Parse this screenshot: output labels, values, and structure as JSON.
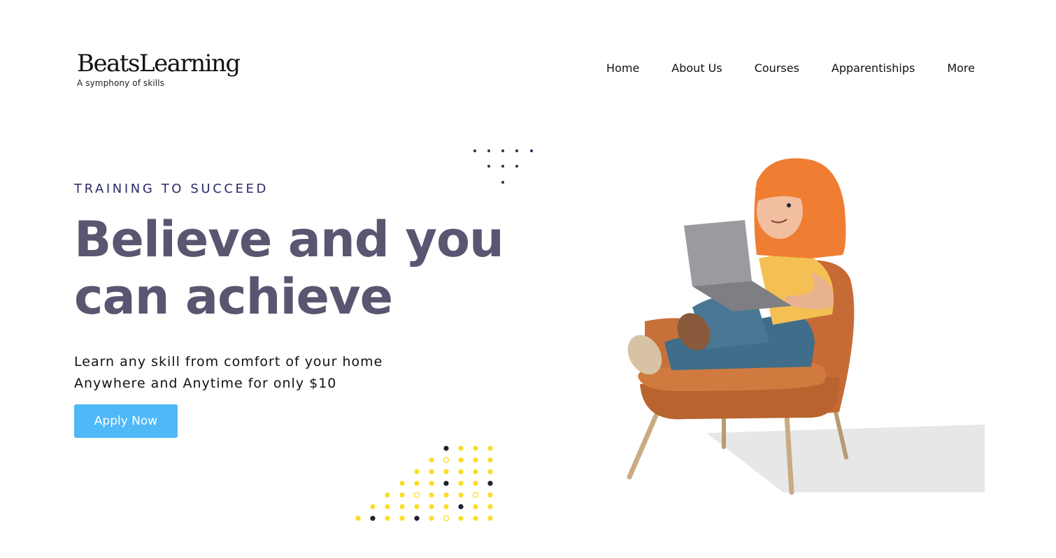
{
  "brand": {
    "name": "BeatsLearning",
    "tagline": "A symphony of skills"
  },
  "nav": {
    "items": [
      {
        "label": "Home"
      },
      {
        "label": "About Us"
      },
      {
        "label": "Courses"
      },
      {
        "label": "Apparentiships"
      },
      {
        "label": "More"
      }
    ]
  },
  "hero": {
    "eyebrow": "TRAINING TO SUCCEED",
    "headline_line1": "Believe and you",
    "headline_line2": "can achieve",
    "sub_line1": "Learn any skill from comfort of your home",
    "sub_line2": "Anywhere and Anytime for only $10",
    "cta_label": "Apply Now"
  },
  "colors": {
    "accent": "#4fb8f7",
    "headline": "#5a5570",
    "eyebrow": "#2c2a6b",
    "dot_yellow": "#fbdd2a",
    "dot_dark": "#1e2230",
    "dot_navy": "#1f3557"
  },
  "illustration": {
    "icon": "person-on-chair-with-laptop-illustration"
  }
}
